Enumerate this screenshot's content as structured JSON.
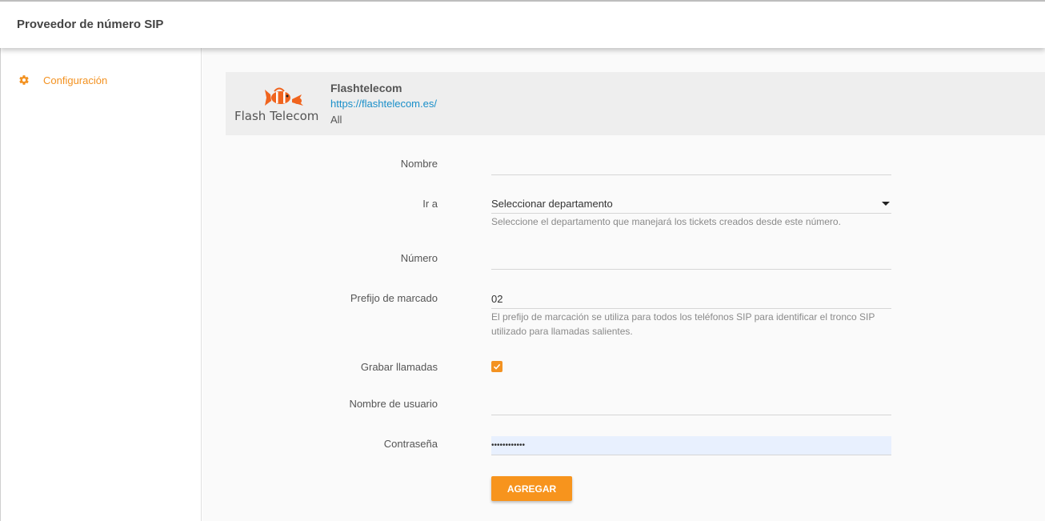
{
  "header": {
    "title": "Proveedor de número SIP"
  },
  "sidebar": {
    "items": [
      {
        "label": "Configuración",
        "icon": "gear-icon"
      }
    ]
  },
  "provider": {
    "name": "Flashtelecom",
    "url": "https://flashtelecom.es/",
    "scope": "All",
    "logo_text": "Flash Telecom"
  },
  "form": {
    "nombre": {
      "label": "Nombre",
      "value": ""
    },
    "ir_a": {
      "label": "Ir a",
      "selected": "Seleccionar departamento",
      "help": "Seleccione el departamento que manejará los tickets creados desde este número."
    },
    "numero": {
      "label": "Número",
      "value": ""
    },
    "prefijo": {
      "label": "Prefijo de marcado",
      "value": "02",
      "help": "El prefijo de marcación se utiliza para todos los teléfonos SIP para identificar el tronco SIP utilizado para llamadas salientes."
    },
    "grabar": {
      "label": "Grabar llamadas",
      "checked": true
    },
    "usuario": {
      "label": "Nombre de usuario",
      "value": ""
    },
    "contrasena": {
      "label": "Contraseña",
      "value": "••••••••••••"
    },
    "submit_label": "AGREGAR"
  },
  "colors": {
    "accent": "#f39221",
    "link": "#1a8fc9",
    "autofill": "#e8f0fe"
  }
}
